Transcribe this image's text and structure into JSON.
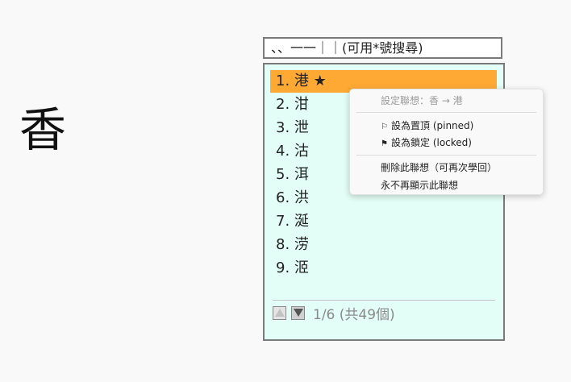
{
  "preview": {
    "char": "香"
  },
  "input": {
    "code": "、、一一｜｜(可用*號搜尋)"
  },
  "candidates": [
    {
      "label": "1. 港 ★"
    },
    {
      "label": "2. 泔"
    },
    {
      "label": "3. 泄"
    },
    {
      "label": "4. 沽"
    },
    {
      "label": "5. 洱"
    },
    {
      "label": "6. 洪"
    },
    {
      "label": "7. 涎"
    },
    {
      "label": "8. 涝"
    },
    {
      "label": "9. 洍"
    }
  ],
  "selected_index": 0,
  "pager": {
    "text": "1/6 (共49個)"
  },
  "context_menu": {
    "header": "設定聯想：香 → 港",
    "pin_label": "設為置頂 (pinned)",
    "lock_label": "設為鎖定 (locked)",
    "delete_label": "刪除此聯想（可再次學回）",
    "hide_label": "永不再顯示此聯想",
    "pin_icon": "⚐",
    "lock_icon": "⚑"
  },
  "colors": {
    "selected_bg": "#ffa935",
    "panel_bg": "#e3fef6"
  }
}
